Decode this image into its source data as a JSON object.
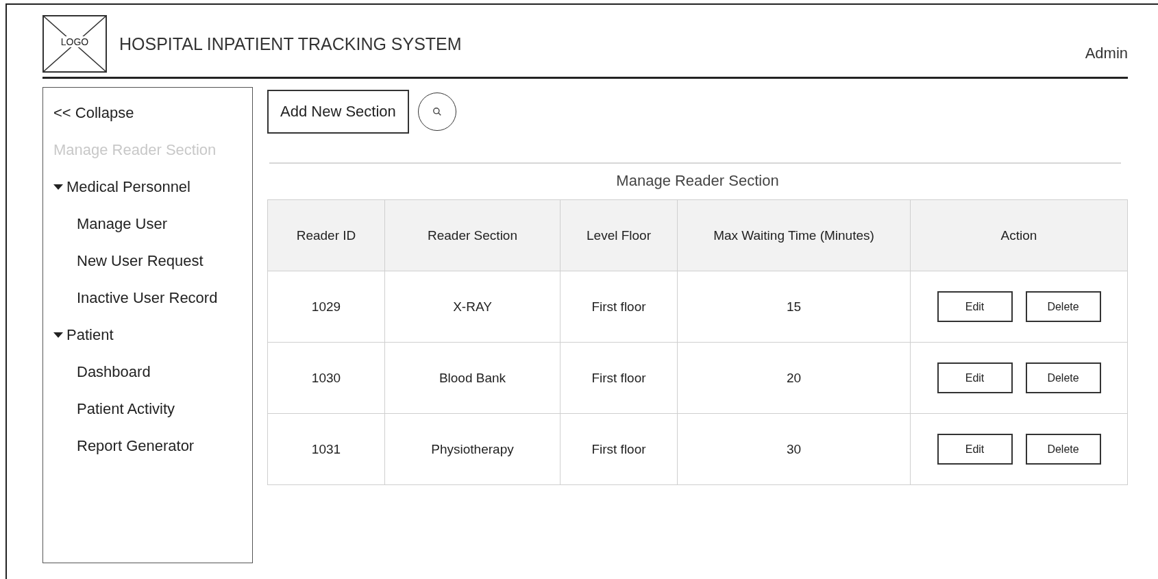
{
  "header": {
    "logo": "LOGO",
    "title": "HOSPITAL INPATIENT TRACKING SYSTEM",
    "user": "Admin"
  },
  "sidebar": {
    "collapse": "<< Collapse",
    "items": [
      {
        "kind": "link",
        "label": "Manage Reader Section",
        "disabled": true
      },
      {
        "kind": "group",
        "label": "Medical Personnel",
        "expanded": true,
        "children": [
          {
            "label": "Manage User",
            "disabled": false
          },
          {
            "label": "New User Request",
            "disabled": false
          },
          {
            "label": "Inactive User Record",
            "disabled": false
          }
        ]
      },
      {
        "kind": "group",
        "label": "Patient",
        "expanded": true,
        "children": [
          {
            "label": "Dashboard",
            "disabled": false
          },
          {
            "label": "Patient Activity",
            "disabled": false
          },
          {
            "label": "Report Generator",
            "disabled": false
          }
        ]
      }
    ]
  },
  "toolbar": {
    "add_button": "Add New Section"
  },
  "table": {
    "caption": "Manage Reader Section",
    "columns": [
      "Reader ID",
      "Reader Section",
      "Level Floor",
      "Max Waiting Time (Minutes)",
      "Action"
    ],
    "rows": [
      {
        "cells": [
          "1029",
          "X-RAY",
          "First floor",
          "15"
        ],
        "actions": [
          "Edit",
          "Delete"
        ]
      },
      {
        "cells": [
          "1030",
          "Blood Bank",
          "First floor",
          "20"
        ],
        "actions": [
          "Edit",
          "Delete"
        ]
      },
      {
        "cells": [
          "1031",
          "Physiotherapy",
          "First floor",
          "30"
        ],
        "actions": [
          "Edit",
          "Delete"
        ]
      }
    ]
  }
}
